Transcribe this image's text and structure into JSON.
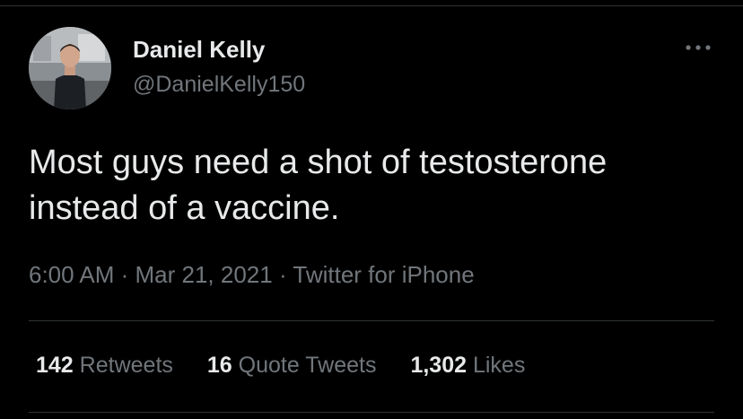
{
  "tweet": {
    "author_name": "Daniel Kelly",
    "author_handle": "@DanielKelly150",
    "more_icon": "more-horizontal-icon",
    "text_line1": "Most guys need a shot of testosterone",
    "text_line2": "instead of a vaccine.",
    "time": "6:00 AM",
    "date": "Mar 21, 2021",
    "source": "Twitter for iPhone",
    "separator": "·",
    "stats": [
      {
        "count": "142",
        "label": "Retweets"
      },
      {
        "count": "16",
        "label": "Quote Tweets"
      },
      {
        "count": "1,302",
        "label": "Likes"
      }
    ]
  },
  "colors": {
    "background": "#000000",
    "primary_text": "#e7e9ea",
    "secondary_text": "#71767b",
    "divider": "#2f3336"
  }
}
